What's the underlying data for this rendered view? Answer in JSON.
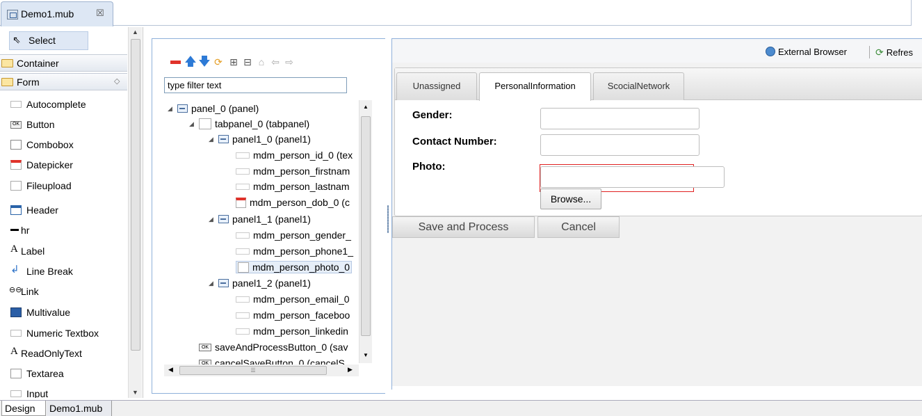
{
  "editor": {
    "tab_title": "Demo1.mub",
    "tab_close": "☒"
  },
  "palette": {
    "select_label": "Select",
    "container_label": "Container",
    "form_label": "Form",
    "form_chevron": "◇",
    "items": [
      {
        "label": "Autocomplete",
        "icon": "textfield-icon"
      },
      {
        "label": "Button",
        "icon": "ok-button-icon"
      },
      {
        "label": "Combobox",
        "icon": "combobox-icon"
      },
      {
        "label": "Datepicker",
        "icon": "calendar-icon"
      },
      {
        "label": "Fileupload",
        "icon": "file-upload-icon"
      },
      {
        "label": "Header",
        "icon": "header-table-icon"
      },
      {
        "label": "hr",
        "icon": "horizontal-rule-icon"
      },
      {
        "label": "Label",
        "icon": "letter-a-icon"
      },
      {
        "label": "Line Break",
        "icon": "line-break-arrow-icon"
      },
      {
        "label": "Link",
        "icon": "chain-link-icon"
      },
      {
        "label": "Multivalue",
        "icon": "multivalue-icon"
      },
      {
        "label": "Numeric Textbox",
        "icon": "textfield-icon"
      },
      {
        "label": "ReadOnlyText",
        "icon": "letter-a-icon"
      },
      {
        "label": "Textarea",
        "icon": "textarea-icon"
      },
      {
        "label": "Input",
        "icon": "textfield-icon"
      }
    ]
  },
  "bottom_tabs": [
    "Design",
    "Demo1.mub"
  ],
  "outline": {
    "filter_placeholder": "type filter text",
    "tree": [
      {
        "label": "panel_0 (panel)",
        "icon": "panel",
        "depth": 0,
        "twisty": "◢"
      },
      {
        "label": "tabpanel_0 (tabpanel)",
        "icon": "tab",
        "depth": 1,
        "twisty": "◢"
      },
      {
        "label": "panel1_0 (panel1)",
        "icon": "panel",
        "depth": 2,
        "twisty": "◢"
      },
      {
        "label": "mdm_person_id_0 (tex",
        "icon": "field",
        "depth": 3
      },
      {
        "label": "mdm_person_firstnam",
        "icon": "field",
        "depth": 3
      },
      {
        "label": "mdm_person_lastnam",
        "icon": "field",
        "depth": 3
      },
      {
        "label": "mdm_person_dob_0 (c",
        "icon": "date",
        "depth": 3
      },
      {
        "label": "panel1_1 (panel1)",
        "icon": "panel",
        "depth": 2,
        "twisty": "◢"
      },
      {
        "label": "mdm_person_gender_",
        "icon": "field",
        "depth": 3
      },
      {
        "label": "mdm_person_phone1_",
        "icon": "field",
        "depth": 3
      },
      {
        "label": "mdm_person_photo_0",
        "icon": "upload",
        "depth": 3,
        "selected": true
      },
      {
        "label": "panel1_2 (panel1)",
        "icon": "panel",
        "depth": 2,
        "twisty": "◢"
      },
      {
        "label": "mdm_person_email_0",
        "icon": "field",
        "depth": 3
      },
      {
        "label": "mdm_person_faceboo",
        "icon": "field",
        "depth": 3
      },
      {
        "label": "mdm_person_linkedin",
        "icon": "field",
        "depth": 3
      },
      {
        "label": "saveAndProcessButton_0 (sav",
        "icon": "button",
        "depth": 1
      },
      {
        "label": "cancelSaveButton_0 (cancelS",
        "icon": "button",
        "depth": 1
      }
    ]
  },
  "browser": {
    "external_browser_label": "External Browser",
    "refresh_label": "Refres",
    "tabs": [
      {
        "label": "Unassigned",
        "active": false
      },
      {
        "label": "PersonalInformation",
        "active": true
      },
      {
        "label": "ScocialNetwork",
        "active": false
      }
    ],
    "fields": {
      "gender_label": "Gender:",
      "gender_value": "",
      "contact_label": "Contact Number:",
      "contact_value": "",
      "photo_label": "Photo:",
      "photo_value": "",
      "browse_label": "Browse..."
    },
    "save_label": "Save and Process",
    "cancel_label": "Cancel"
  },
  "colors": {
    "accent_border": "#8fb0da",
    "error_red": "#e02020",
    "selection_bg": "#e6eef8"
  }
}
